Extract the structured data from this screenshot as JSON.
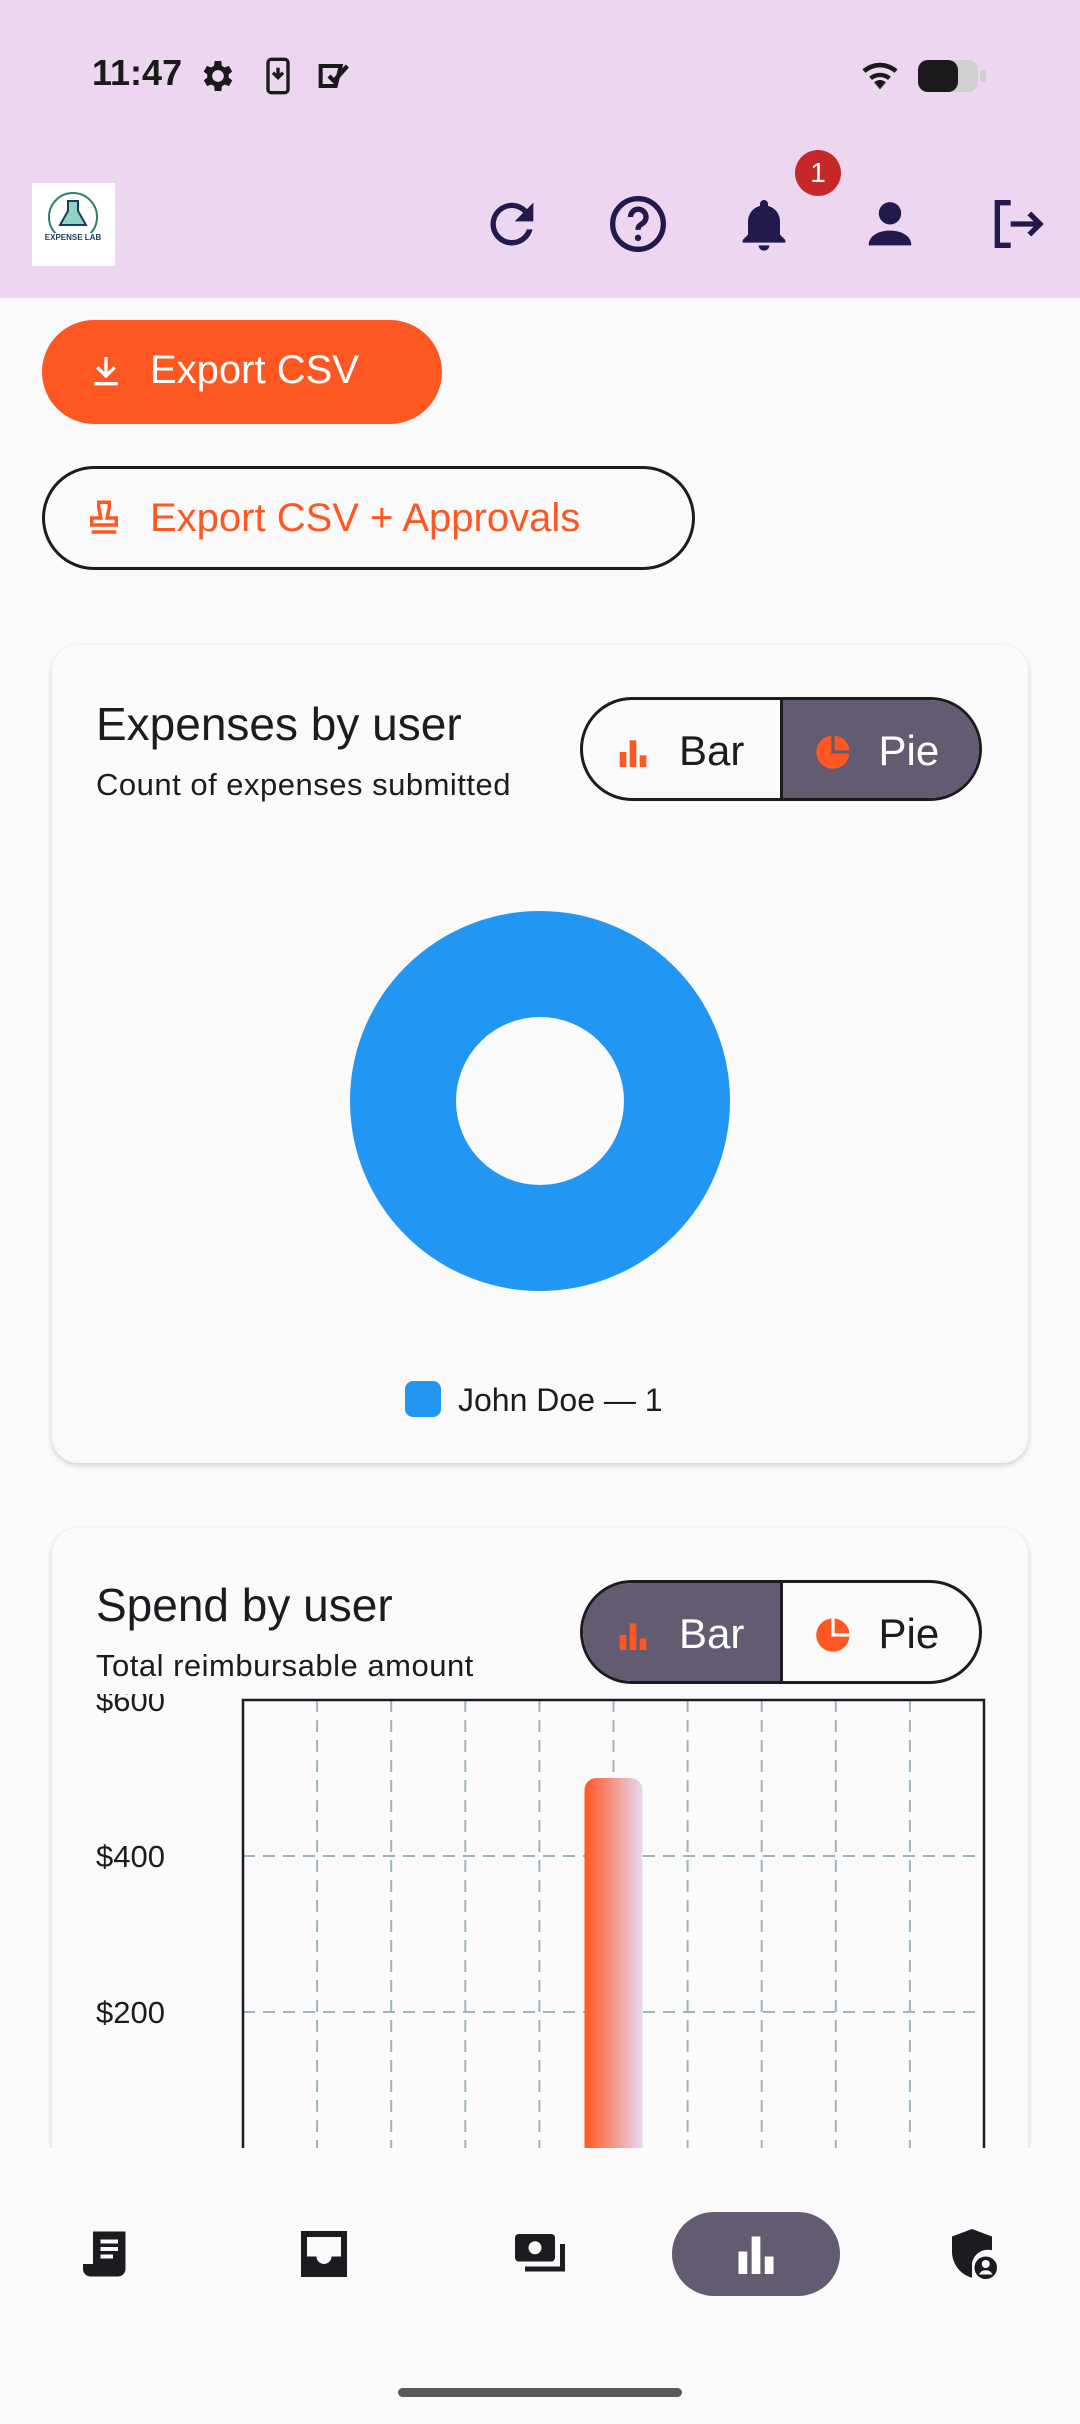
{
  "status_bar": {
    "time": "11:47"
  },
  "app_bar": {
    "logo_text": "EXPENSE LAB",
    "notification_count": "1"
  },
  "actions": {
    "export_csv": "Export CSV",
    "export_csv_approvals": "Export CSV + Approvals"
  },
  "expenses_card": {
    "title": "Expenses by user",
    "subtitle": "Count of expenses submitted",
    "toggle": {
      "bar": "Bar",
      "pie": "Pie",
      "selected": "Pie"
    },
    "legend": "John Doe — 1"
  },
  "spend_card": {
    "title": "Spend by user",
    "subtitle": "Total reimbursable amount",
    "toggle": {
      "bar": "Bar",
      "pie": "Pie",
      "selected": "Bar"
    }
  },
  "chart_data": [
    {
      "type": "pie",
      "title": "Expenses by user",
      "subtitle": "Count of expenses submitted",
      "slices": [
        {
          "label": "John Doe",
          "value": 1,
          "color": "#2196f3"
        }
      ],
      "donut": true,
      "legend": "bottom"
    },
    {
      "type": "bar",
      "title": "Spend by user",
      "subtitle": "Total reimbursable amount",
      "ylim": [
        0,
        600
      ],
      "yticks": [
        "$200",
        "$400",
        "$600"
      ],
      "ytick_values": [
        200,
        400,
        600
      ],
      "values": [
        500
      ],
      "bar_color_start": "#ff5722",
      "bar_color_end": "#e8d8f0",
      "grid": true
    }
  ],
  "bottom_nav": {
    "items": [
      "receipt-icon",
      "inbox-icon",
      "payments-icon",
      "bar-chart-icon",
      "admin-shield-icon"
    ],
    "selected": "bar-chart-icon"
  },
  "colors": {
    "accent": "#ff5722",
    "appbar": "#ecd6f0",
    "selected": "#625b71",
    "pie": "#2196f3"
  }
}
